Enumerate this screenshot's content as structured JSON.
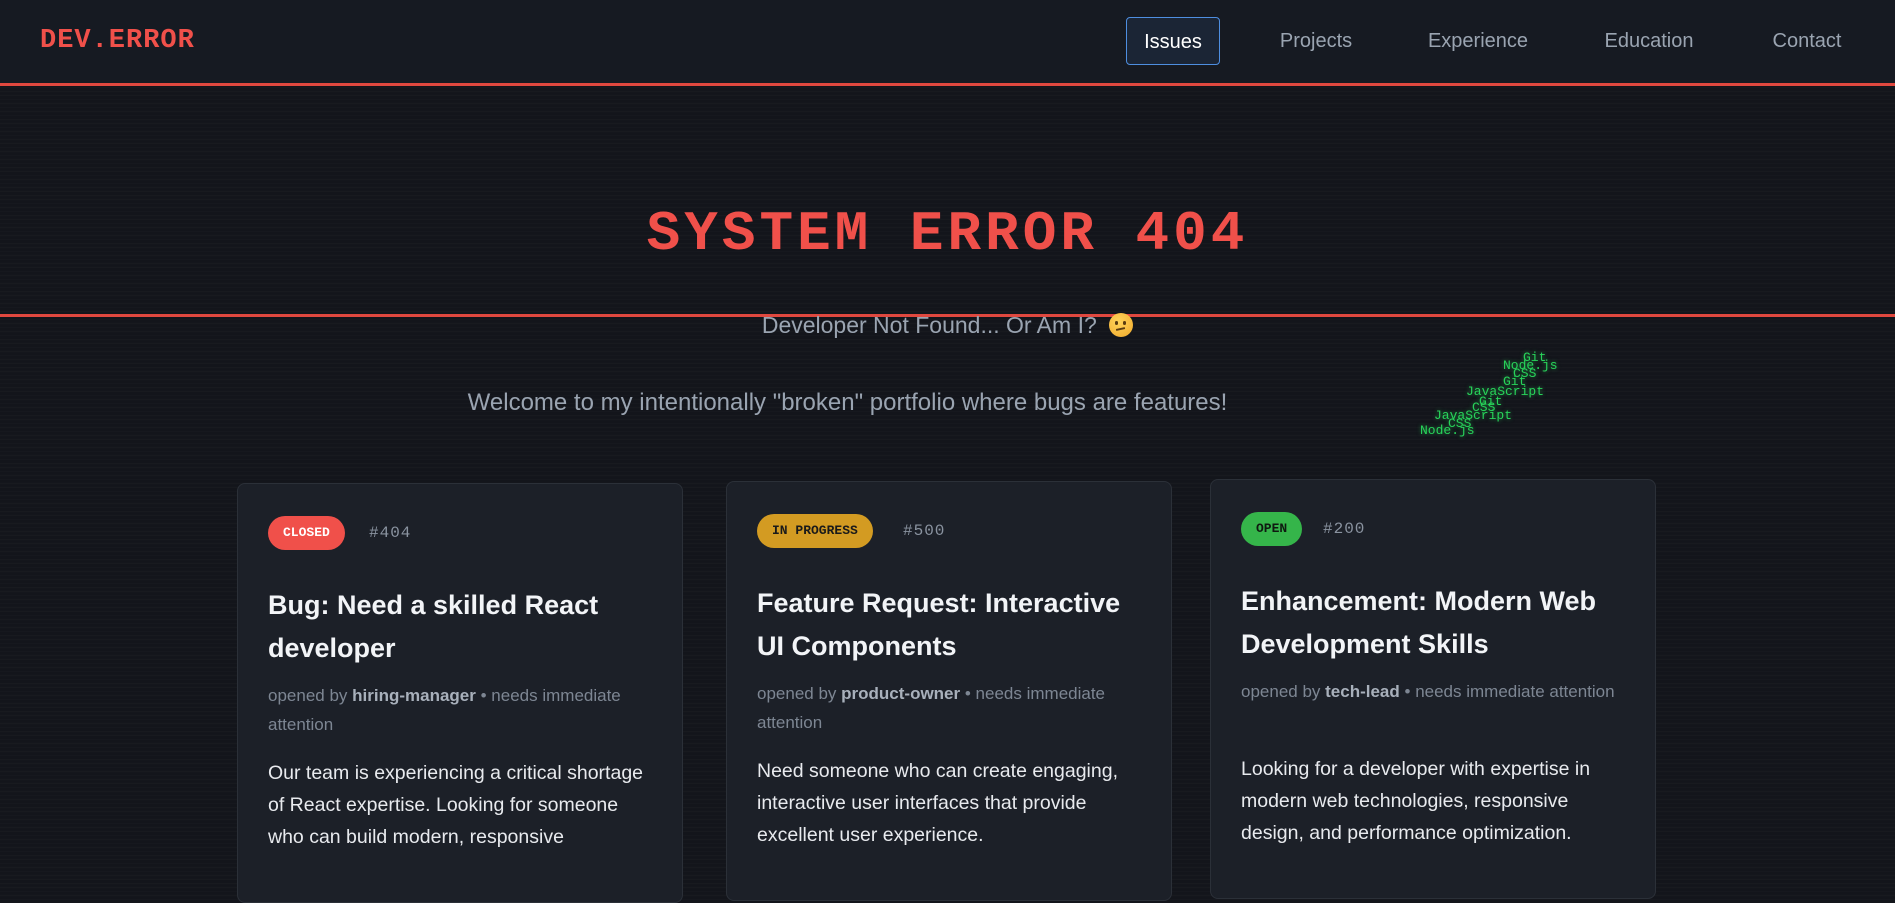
{
  "logo": "DEV.ERROR",
  "nav": {
    "items": [
      "Issues",
      "Projects",
      "Experience",
      "Education",
      "Contact"
    ],
    "active": "Issues"
  },
  "hero": {
    "title": "SYSTEM ERROR 404",
    "subtitle": "Developer Not Found... Or Am I?",
    "subtitle_emoji": "thinking-face-icon",
    "welcome": "Welcome to my intentionally \"broken\" portfolio where bugs are features!"
  },
  "falling_tech": [
    "Git",
    "Node.js",
    "CSS",
    "Git",
    "JavaScript",
    "Git",
    "CSS",
    "JavaScript",
    "CSS",
    "Node.js"
  ],
  "cards": [
    {
      "status": "CLOSED",
      "status_color": "#f0504a",
      "number": "#404",
      "title": "Bug: Need a skilled React developer",
      "meta_prefix": "opened by",
      "author": "hiring-manager",
      "meta_suffix": "• needs immediate attention",
      "description": "Our team is experiencing a critical shortage of React expertise. Looking for someone who can build modern, responsive"
    },
    {
      "status": "IN PROGRESS",
      "status_color": "#d39b22",
      "number": "#500",
      "title": "Feature Request: Interactive UI Components",
      "meta_prefix": "opened by",
      "author": "product-owner",
      "meta_suffix": "• needs immediate attention",
      "description": "Need someone who can create engaging, interactive user interfaces that provide excellent user experience."
    },
    {
      "status": "OPEN",
      "status_color": "#35b54a",
      "number": "#200",
      "title": "Enhancement: Modern Web Development Skills",
      "meta_prefix": "opened by",
      "author": "tech-lead",
      "meta_suffix": "• needs immediate attention",
      "description": "Looking for a developer with expertise in modern web technologies, responsive design, and performance optimization."
    }
  ],
  "colors": {
    "accent_red": "#e0483f",
    "background": "#13151b",
    "nav_active_border": "#4e8ee0",
    "matrix_green": "#28d35a"
  }
}
